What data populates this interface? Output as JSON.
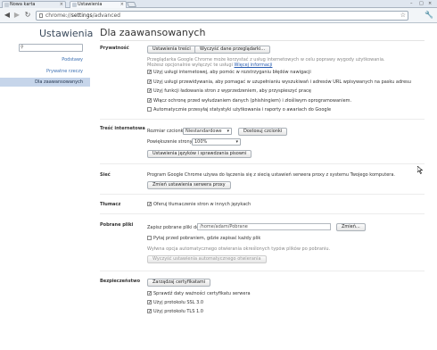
{
  "tabs": [
    {
      "label": "Nowa karta"
    },
    {
      "label": "Ustawienia"
    }
  ],
  "toolbar": {
    "url_scheme": "chrome://",
    "url_host": "settings",
    "url_path": "/advanced"
  },
  "sidebar": {
    "title": "Ustawienia",
    "search_placeholder": "",
    "items": [
      {
        "label": "Podstawy"
      },
      {
        "label": "Prywatne rzeczy"
      },
      {
        "label": "Dla zaawansowanych"
      }
    ]
  },
  "main": {
    "title": "Dla zaawansowanych",
    "privacy": {
      "label": "Prywatność",
      "content_settings_button": "Ustawienia treści",
      "clear_data_button": "Wyczyść dane przeglądarki...",
      "info_line1": "Przeglądarka Google Chrome może korzystać z usług internetowych w celu poprawy wygody użytkowania.",
      "info_line2": "Możesz opcjonalnie wyłączyć te usługi",
      "info_link": "Więcej informacji",
      "options": [
        {
          "label": "Użyj usługi internetowej, aby pomóc w rozstrzyganiu błędów nawigacji",
          "checked": true
        },
        {
          "label": "Użyj usługi przewidywania, aby pomagać w uzupełnianiu wyszukiwań i adresów URL wpisywanych na pasku adresu",
          "checked": true
        },
        {
          "label": "Użyj funkcji ładowania stron z wyprzedzeniem, aby przyspieszyć pracę",
          "checked": true
        },
        {
          "label": "Włącz ochronę przed wyłudzaniem danych (phishingiem) i złośliwym oprogramowaniem.",
          "checked": true
        },
        {
          "label": "Automatycznie przesyłaj statystyki użytkowania i raporty o awariach do Google",
          "checked": false
        }
      ]
    },
    "web_content": {
      "label": "Treść internetowa",
      "font_size_label": "Rozmiar czcionki:",
      "font_size_value": "Niestandardowe",
      "customize_fonts_button": "Dostosuj czcionki",
      "zoom_label": "Powiększenie strony:",
      "zoom_value": "100%",
      "languages_button": "Ustawienia języków i sprawdzania pisowni"
    },
    "network": {
      "label": "Sieć",
      "description": "Program Google Chrome używa do łączenia się z siecią ustawień serwera proxy z systemu Twojego komputera.",
      "proxy_button": "Zmień ustawienia serwera proxy"
    },
    "translate": {
      "label": "Tłumacz",
      "option": {
        "label": "Oferuj tłumaczenie stron w innych językach",
        "checked": true
      }
    },
    "downloads": {
      "label": "Pobrane pliki",
      "location_label": "Zapisz pobrane pliki do:",
      "location_value": "/home/adam/Pobrane",
      "change_button": "Zmień...",
      "ask_option": {
        "label": "Pytaj przed pobraniem, gdzie zapisać każdy plik",
        "checked": false
      },
      "auto_open_note": "Wyłwna opcja automatycznego otwierania określonych typów plików po pobraniu.",
      "reset_auto_open_button": "Wyczyść ustawienia automatycznego otwierania"
    },
    "security": {
      "label": "Bezpieczeństwo",
      "certificates_button": "Zarządzaj certyfikatami",
      "options": [
        {
          "label": "Sprawdź daty ważności certyfikatu serwera",
          "checked": true
        },
        {
          "label": "Użyj protokołu SSL 3.0",
          "checked": true
        },
        {
          "label": "Użyj protokołu TLS 1.0",
          "checked": true
        }
      ]
    }
  },
  "colors": {
    "accent_link": "#3b6fb2",
    "sidebar_selected": "#c6d5ea"
  }
}
